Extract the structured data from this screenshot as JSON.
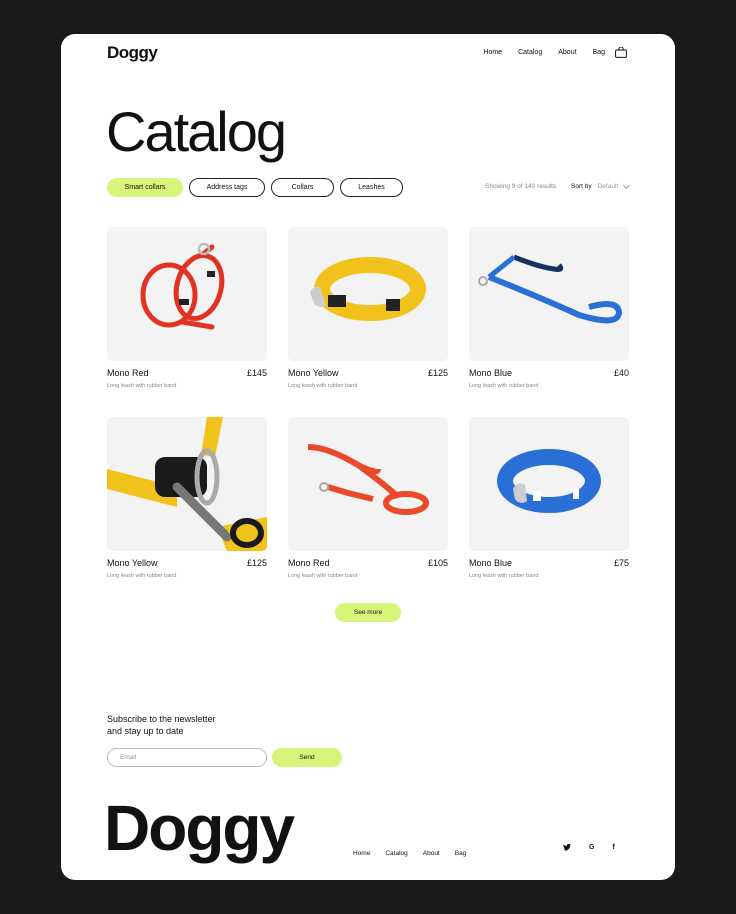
{
  "brand": "Doggy",
  "nav": {
    "items": [
      "Home",
      "Catalog",
      "About",
      "Bag"
    ]
  },
  "page_title": "Catalog",
  "filters": [
    {
      "label": "Smart collars",
      "active": true
    },
    {
      "label": "Address tags",
      "active": false
    },
    {
      "label": "Collars",
      "active": false
    },
    {
      "label": "Leashes",
      "active": false
    }
  ],
  "results_text": "Showing 9 of 140 results",
  "sort": {
    "label": "Sort by",
    "value": "Default"
  },
  "products": [
    {
      "name": "Mono Red",
      "price": "£145",
      "desc": "Long leash with rubber band",
      "kind": "harness",
      "color": "#e23322"
    },
    {
      "name": "Mono Yellow",
      "price": "£125",
      "desc": "Long leash with rubber band",
      "kind": "collar",
      "color": "#f1c21b"
    },
    {
      "name": "Mono Blue",
      "price": "£40",
      "desc": "Long leash with rubber band",
      "kind": "leash",
      "color": "#2a6fd6"
    },
    {
      "name": "Mono Yellow",
      "price": "£125",
      "desc": "Long leash with rubber band",
      "kind": "harness-close",
      "color": "#f1c21b"
    },
    {
      "name": "Mono Red",
      "price": "£105",
      "desc": "Long leash with rubber band",
      "kind": "leash",
      "color": "#ea4a2a"
    },
    {
      "name": "Mono Blue",
      "price": "£75",
      "desc": "Long leash with rubber band",
      "kind": "collar",
      "color": "#2a6fd6"
    }
  ],
  "see_more": "See more",
  "newsletter": {
    "title": "Subscribe to the newsletter\nand stay up to date",
    "placeholder": "Email",
    "button": "Send"
  },
  "footer": {
    "brand": "Doggy",
    "nav": [
      "Home",
      "Catalog",
      "About",
      "Bag"
    ],
    "social": [
      "twitter-icon",
      "google-icon",
      "facebook-icon"
    ]
  },
  "colors": {
    "accent": "#d7f57a",
    "background": "#1a1a1a",
    "card": "#f3f3f3"
  }
}
